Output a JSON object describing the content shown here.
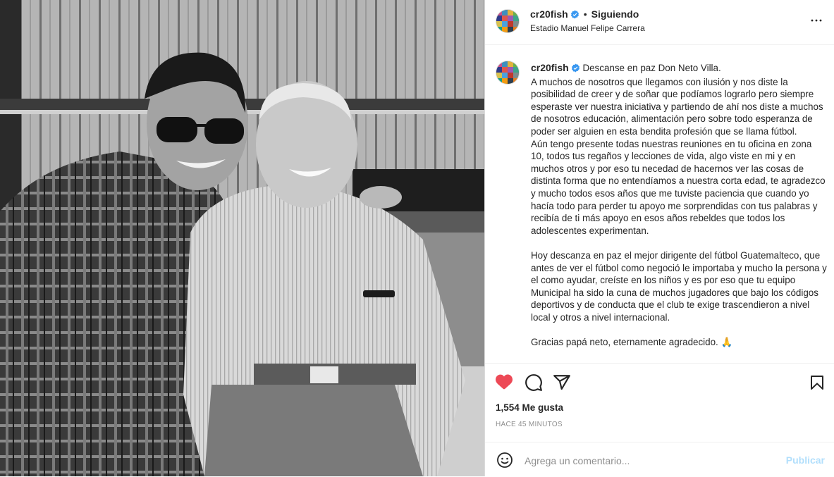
{
  "post": {
    "username": "cr20fish",
    "verified": true,
    "follow_status": "Siguiendo",
    "separator": "•",
    "location": "Estadio Manuel Felipe Carrera"
  },
  "caption": {
    "username": "cr20fish",
    "text": "Descanse en paz Don Neto Villa.\nA muchos de nosotros que llegamos con ilusión y nos diste la posibilidad de creer y de soñar que podíamos lograrlo pero siempre esperaste ver nuestra iniciativa y partiendo de ahí nos diste a muchos de nosotros educación, alimentación pero sobre todo esperanza de poder ser alguien en esta bendita profesión que se llama fútbol.\nAún tengo presente todas nuestras reuniones en tu oficina en zona 10, todos tus regaños y lecciones de vida, algo viste en mi y en muchos otros y por eso tu necedad de hacernos ver las cosas de distinta forma que no entendíamos a nuestra corta edad, te agradezco y mucho todos esos años que me tuviste paciencia que cuando yo hacía todo para perder tu apoyo me sorprendidas con tus palabras y recibía de ti más apoyo en esos años rebeldes que todos los adolescentes experimentan.\n\nHoy descanza en paz el mejor dirigente del fútbol Guatemalteco, que antes de ver el fútbol como negoció le importaba y mucho la persona y el como ayudar, creíste en los niños y es por eso que tu equipo Municipal ha sido la cuna de muchos jugadores que bajo los códigos deportivos y de conducta que el club te exige trascendieron a nivel local y otros a nivel internacional.\n\nGracias papá neto, eternamente agradecido. 🙏"
  },
  "engagement": {
    "likes": "1,554 Me gusta",
    "timestamp": "HACE 45 MINUTOS",
    "liked": true
  },
  "comment_box": {
    "placeholder": "Agrega un comentario...",
    "submit_label": "Publicar"
  },
  "icons": {
    "like": "heart-icon",
    "comment": "comment-icon",
    "share": "share-icon",
    "save": "bookmark-icon",
    "more": "more-options-icon",
    "emoji": "emoji-icon"
  },
  "colors": {
    "liked": "#ed4956",
    "verified": "#3897f0",
    "publish_disabled": "#b2dffc",
    "secondary_text": "#8e8e8e"
  }
}
